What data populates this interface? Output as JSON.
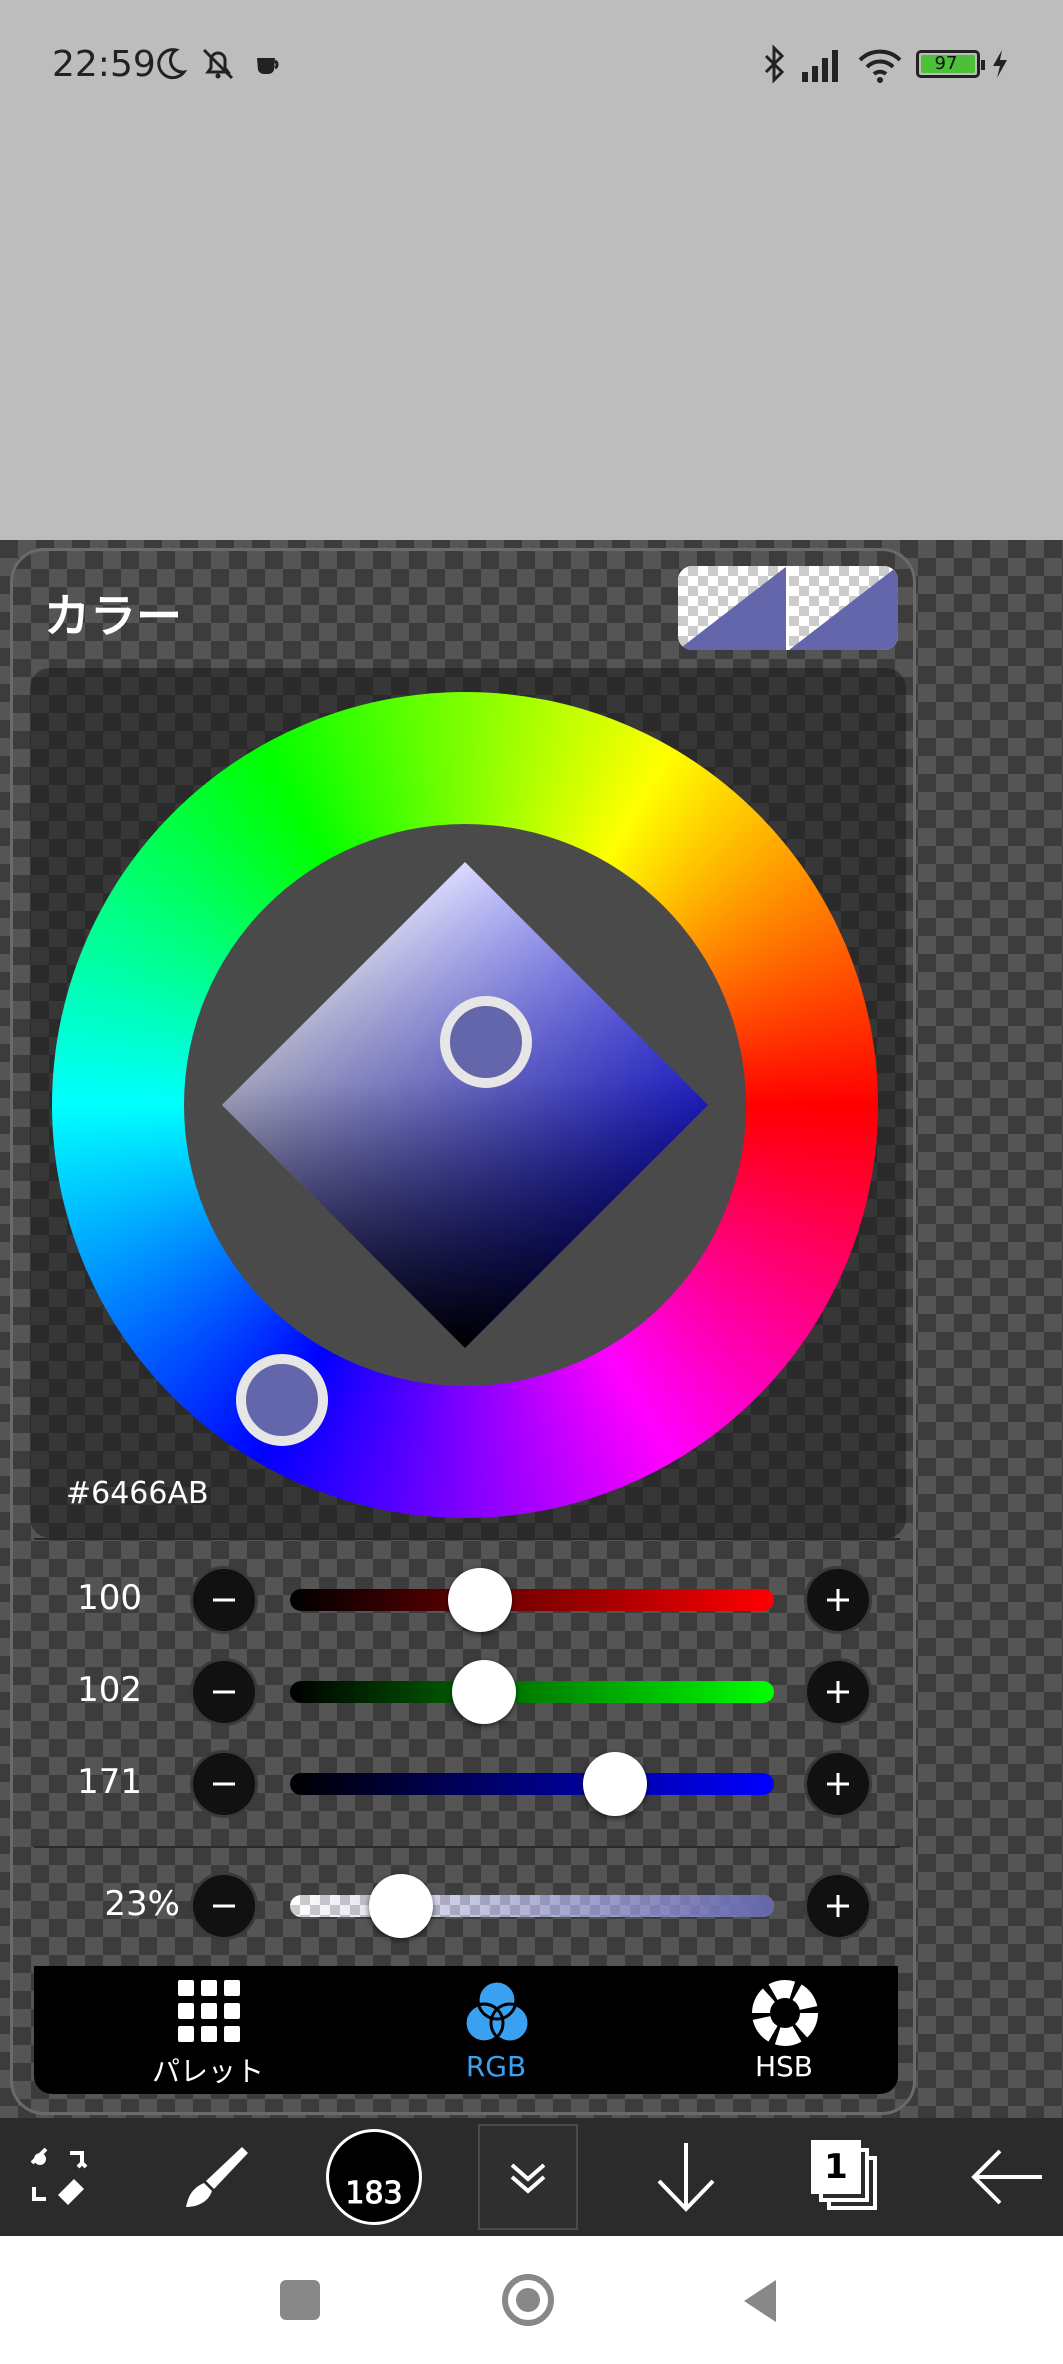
{
  "status_bar": {
    "time": "22:59",
    "battery": "97",
    "icons": [
      "moon-icon",
      "bell-off-icon",
      "coffee-icon",
      "bluetooth-icon",
      "signal-icon",
      "wifi-icon",
      "battery-icon",
      "charging-icon"
    ]
  },
  "panel": {
    "title": "カラー",
    "hex_value": "#6466AB",
    "selected_color": "#6466ab",
    "sliders": {
      "red": {
        "value": "100",
        "fraction": 0.392
      },
      "green": {
        "value": "102",
        "fraction": 0.4
      },
      "blue": {
        "value": "171",
        "fraction": 0.671
      },
      "alpha": {
        "value": "23%",
        "fraction": 0.23
      }
    },
    "tabs": [
      {
        "label": "パレット",
        "icon": "grid-icon",
        "active": false
      },
      {
        "label": "RGB",
        "icon": "rgb-circles-icon",
        "active": true
      },
      {
        "label": "HSB",
        "icon": "hsb-ring-icon",
        "active": false
      }
    ],
    "accent_color": "#3aa0f0"
  },
  "toolbar": {
    "brush_size": "183",
    "layer_count": "1",
    "tools": [
      "swap-tool-icon",
      "brush-icon",
      "brush-size-icon",
      "chevron-down-icon",
      "arrow-down-icon",
      "layers-icon",
      "back-arrow-icon"
    ]
  },
  "navbar": {
    "buttons": [
      "recent-apps-button",
      "home-button",
      "back-button"
    ]
  }
}
